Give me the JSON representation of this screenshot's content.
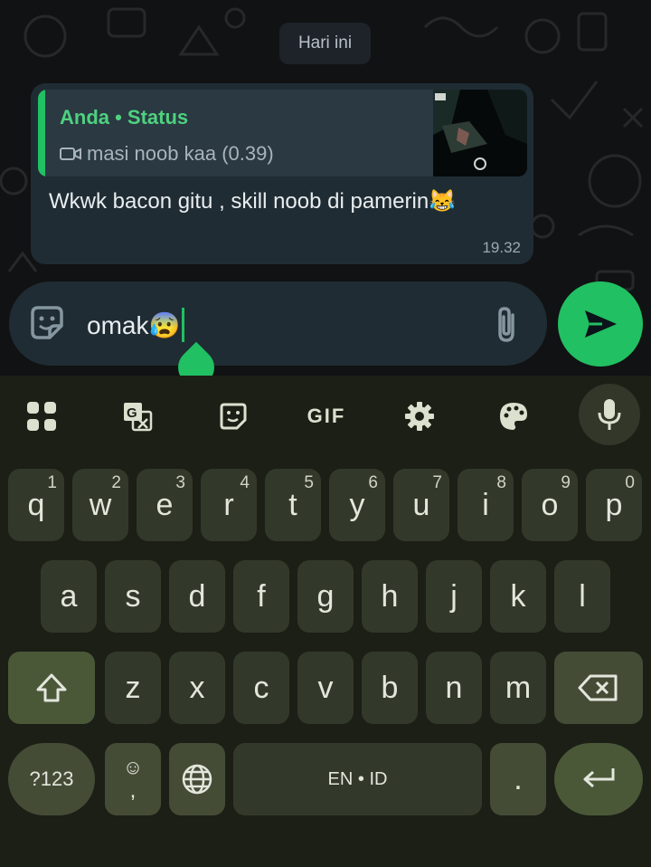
{
  "chat": {
    "date_label": "Hari ini",
    "message": {
      "quote_title": "Anda • Status",
      "quote_subtitle": "masi noob kaa (0.39)",
      "text": "Wkwk bacon gitu , skill noob di pamerin😹",
      "time": "19.32"
    }
  },
  "composer": {
    "input_value": "omak😰",
    "icons": [
      "sticker-icon",
      "attach-icon",
      "send-icon"
    ]
  },
  "keyboard": {
    "toolbar": [
      "apps-grid-icon",
      "translate-icon",
      "sticker-icon",
      "GIF",
      "settings-icon",
      "palette-icon",
      "mic-icon"
    ],
    "gif_label": "GIF",
    "row1": [
      {
        "key": "q",
        "hint": "1"
      },
      {
        "key": "w",
        "hint": "2"
      },
      {
        "key": "e",
        "hint": "3"
      },
      {
        "key": "r",
        "hint": "4"
      },
      {
        "key": "t",
        "hint": "5"
      },
      {
        "key": "y",
        "hint": "6"
      },
      {
        "key": "u",
        "hint": "7"
      },
      {
        "key": "i",
        "hint": "8"
      },
      {
        "key": "o",
        "hint": "9"
      },
      {
        "key": "p",
        "hint": "0"
      }
    ],
    "row2": [
      "a",
      "s",
      "d",
      "f",
      "g",
      "h",
      "j",
      "k",
      "l"
    ],
    "row3": [
      "z",
      "x",
      "c",
      "v",
      "b",
      "n",
      "m"
    ],
    "symbols_label": "?123",
    "emoji_hint": "☺",
    "comma": ",",
    "space_label": "EN • ID",
    "period": "."
  },
  "colors": {
    "accent": "#21c063",
    "bubble": "#1f2c33",
    "keyboard_bg": "#1c1f16",
    "key_bg": "#33392a"
  }
}
